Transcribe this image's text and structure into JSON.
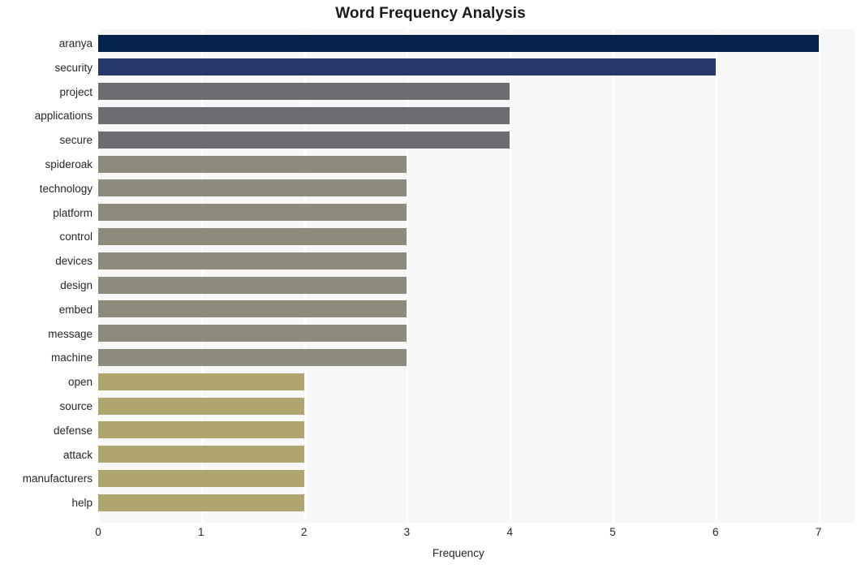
{
  "chart_data": {
    "type": "bar",
    "orientation": "horizontal",
    "title": "Word Frequency Analysis",
    "xlabel": "Frequency",
    "ylabel": "",
    "xlim": [
      0,
      7.35
    ],
    "xticks": [
      0,
      1,
      2,
      3,
      4,
      5,
      6,
      7
    ],
    "xtick_labels": [
      "0",
      "1",
      "2",
      "3",
      "4",
      "5",
      "6",
      "7"
    ],
    "grid": true,
    "grid_axis": "x",
    "grid_color": "#ffffff",
    "plot_background": "#f7f7f8",
    "figure_background": "#ffffff",
    "legend": null,
    "categories": [
      "aranya",
      "security",
      "project",
      "applications",
      "secure",
      "spideroak",
      "technology",
      "platform",
      "control",
      "devices",
      "design",
      "embed",
      "message",
      "machine",
      "open",
      "source",
      "defense",
      "attack",
      "manufacturers",
      "help"
    ],
    "values": [
      7,
      6,
      4,
      4,
      4,
      3,
      3,
      3,
      3,
      3,
      3,
      3,
      3,
      3,
      2,
      2,
      2,
      2,
      2,
      2
    ],
    "bar_colors": [
      "#04224d",
      "#25396b",
      "#6b6d72",
      "#6b6d72",
      "#6b6d72",
      "#8f8b7b",
      "#8f8b7b",
      "#8f8b7b",
      "#8f8b7b",
      "#8f8b7b",
      "#8f8b7b",
      "#8f8b7b",
      "#8f8b7b",
      "#8f8b7b",
      "#b0a56f",
      "#b0a56f",
      "#b0a56f",
      "#b0a56f",
      "#b0a56f",
      "#b0a56f"
    ],
    "bars": [
      {
        "label": "aranya",
        "value": 7,
        "color": "#04224d"
      },
      {
        "label": "security",
        "value": 6,
        "color": "#25396b"
      },
      {
        "label": "project",
        "value": 4,
        "color": "#6b6d72"
      },
      {
        "label": "applications",
        "value": 4,
        "color": "#6b6d72"
      },
      {
        "label": "secure",
        "value": 4,
        "color": "#6b6d72"
      },
      {
        "label": "spideroak",
        "value": 3,
        "color": "#8f8b7b"
      },
      {
        "label": "technology",
        "value": 3,
        "color": "#8f8b7b"
      },
      {
        "label": "platform",
        "value": 3,
        "color": "#8f8b7b"
      },
      {
        "label": "control",
        "value": 3,
        "color": "#8f8b7b"
      },
      {
        "label": "devices",
        "value": 3,
        "color": "#8f8b7b"
      },
      {
        "label": "design",
        "value": 3,
        "color": "#8f8b7b"
      },
      {
        "label": "embed",
        "value": 3,
        "color": "#8f8b7b"
      },
      {
        "label": "message",
        "value": 3,
        "color": "#8f8b7b"
      },
      {
        "label": "machine",
        "value": 3,
        "color": "#8f8b7b"
      },
      {
        "label": "open",
        "value": 2,
        "color": "#b0a56f"
      },
      {
        "label": "source",
        "value": 2,
        "color": "#b0a56f"
      },
      {
        "label": "defense",
        "value": 2,
        "color": "#b0a56f"
      },
      {
        "label": "attack",
        "value": 2,
        "color": "#b0a56f"
      },
      {
        "label": "manufacturers",
        "value": 2,
        "color": "#b0a56f"
      },
      {
        "label": "help",
        "value": 2,
        "color": "#b0a56f"
      }
    ]
  }
}
